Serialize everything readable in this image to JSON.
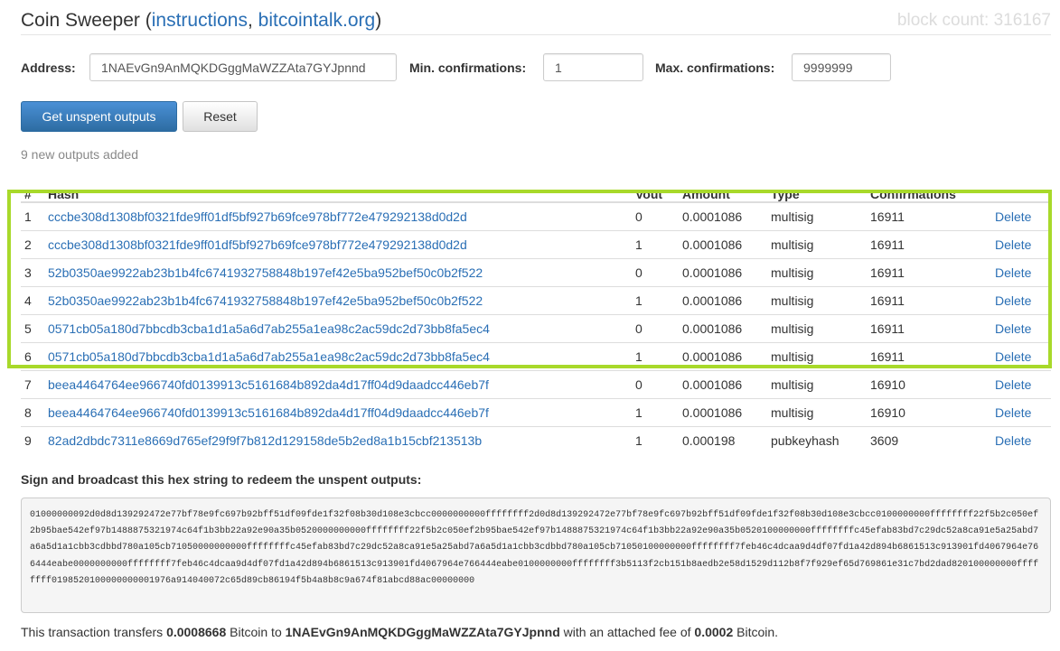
{
  "header": {
    "app_name": "Coin Sweeper",
    "open_paren": "(",
    "instructions_link": "instructions",
    "comma": ", ",
    "forum_link": "bitcointalk.org",
    "close_paren": ")",
    "block_count": "block count: 316167"
  },
  "form": {
    "address_label": "Address:",
    "address_value": "1NAEvGn9AnMQKDGggMaWZZAta7GYJpnnd",
    "min_conf_label": "Min. confirmations:",
    "min_conf_value": "1",
    "max_conf_label": "Max. confirmations:",
    "max_conf_value": "9999999"
  },
  "buttons": {
    "get_outputs": "Get unspent outputs",
    "reset": "Reset"
  },
  "status": "9 new outputs added",
  "table": {
    "headers": [
      "#",
      "Hash",
      "Vout",
      "Amount",
      "Type",
      "Confirmations",
      ""
    ],
    "rows": [
      {
        "n": "1",
        "hash": "cccbe308d1308bf0321fde9ff01df5bf927b69fce978bf772e479292138d0d2d",
        "vout": "0",
        "amount": "0.0001086",
        "type": "multisig",
        "conf": "16911",
        "action": "Delete"
      },
      {
        "n": "2",
        "hash": "cccbe308d1308bf0321fde9ff01df5bf927b69fce978bf772e479292138d0d2d",
        "vout": "1",
        "amount": "0.0001086",
        "type": "multisig",
        "conf": "16911",
        "action": "Delete"
      },
      {
        "n": "3",
        "hash": "52b0350ae9922ab23b1b4fc6741932758848b197ef42e5ba952bef50c0b2f522",
        "vout": "0",
        "amount": "0.0001086",
        "type": "multisig",
        "conf": "16911",
        "action": "Delete"
      },
      {
        "n": "4",
        "hash": "52b0350ae9922ab23b1b4fc6741932758848b197ef42e5ba952bef50c0b2f522",
        "vout": "1",
        "amount": "0.0001086",
        "type": "multisig",
        "conf": "16911",
        "action": "Delete"
      },
      {
        "n": "5",
        "hash": "0571cb05a180d7bbcdb3cba1d1a5a6d7ab255a1ea98c2ac59dc2d73bb8fa5ec4",
        "vout": "0",
        "amount": "0.0001086",
        "type": "multisig",
        "conf": "16911",
        "action": "Delete"
      },
      {
        "n": "6",
        "hash": "0571cb05a180d7bbcdb3cba1d1a5a6d7ab255a1ea98c2ac59dc2d73bb8fa5ec4",
        "vout": "1",
        "amount": "0.0001086",
        "type": "multisig",
        "conf": "16911",
        "action": "Delete"
      },
      {
        "n": "7",
        "hash": "beea4464764ee966740fd0139913c5161684b892da4d17ff04d9daadcc446eb7f",
        "vout": "0",
        "amount": "0.0001086",
        "type": "multisig",
        "conf": "16910",
        "action": "Delete"
      },
      {
        "n": "8",
        "hash": "beea4464764ee966740fd0139913c5161684b892da4d17ff04d9daadcc446eb7f",
        "vout": "1",
        "amount": "0.0001086",
        "type": "multisig",
        "conf": "16910",
        "action": "Delete"
      },
      {
        "n": "9",
        "hash": "82ad2dbdc7311e8669d765ef29f9f7b812d129158de5b2ed8a1b15cbf213513b",
        "vout": "1",
        "amount": "0.000198",
        "type": "pubkeyhash",
        "conf": "3609",
        "action": "Delete"
      }
    ]
  },
  "sign": {
    "label": "Sign and broadcast this hex string to redeem the unspent outputs:",
    "hex": "01000000092d0d8d139292472e77bf78e9fc697b92bff51df09fde1f32f08b30d108e3cbcc0000000000ffffffff2d0d8d139292472e77bf78e9fc697b92bff51df09fde1f32f08b30d108e3cbcc0100000000ffffffff22f5b2c050ef2b95bae542ef97b1488875321974c64f1b3bb22a92e90a35b0520000000000ffffffff22f5b2c050ef2b95bae542ef97b1488875321974c64f1b3bb22a92e90a35b0520100000000ffffffffc45efab83bd7c29dc52a8ca91e5a25abd7a6a5d1a1cbb3cdbbd780a105cb71050000000000ffffffffc45efab83bd7c29dc52a8ca91e5a25abd7a6a5d1a1cbb3cdbbd780a105cb71050100000000ffffffff7feb46c4dcaa9d4df07fd1a42d894b6861513c913901fd4067964e766444eabe0000000000ffffffff7feb46c4dcaa9d4df07fd1a42d894b6861513c913901fd4067964e766444eabe0100000000ffffffff3b5113f2cb151b8aedb2e58d1529d112b8f7f929ef65d769861e31c7bd2dad820100000000ffffffff0198520100000000001976a914040072c65d89cb86194f5b4a8b8c9a674f81abcd88ac00000000"
  },
  "footer": {
    "prefix": "This transaction transfers ",
    "amount": "0.0008668",
    "mid1": " Bitcoin to ",
    "address": "1NAEvGn9AnMQKDGggMaWZZAta7GYJpnnd",
    "mid2": " with an attached fee of ",
    "fee": "0.0002",
    "suffix": " Bitcoin."
  },
  "colors": {
    "link": "#2a6fb5",
    "primary_button": "#3276b1",
    "highlight_border": "#a8d92a"
  }
}
